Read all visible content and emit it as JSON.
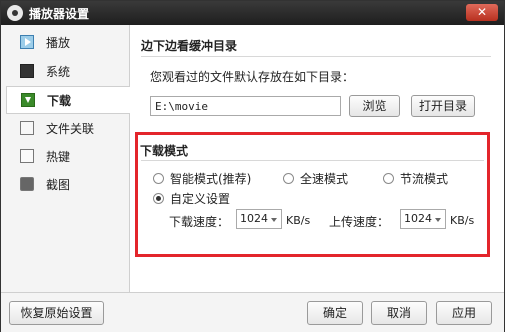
{
  "window": {
    "title": "播放器设置",
    "close_label": "✕"
  },
  "sidebar": {
    "items": [
      {
        "label": "播放",
        "icon": "play-icon"
      },
      {
        "label": "系统",
        "icon": "system-icon"
      },
      {
        "label": "下载",
        "icon": "download-icon"
      },
      {
        "label": "文件关联",
        "icon": "file-association-icon"
      },
      {
        "label": "热键",
        "icon": "hotkey-icon"
      },
      {
        "label": "截图",
        "icon": "camera-icon"
      }
    ],
    "active_index": 2
  },
  "cache": {
    "title": "边下边看缓冲目录",
    "hint": "您观看过的文件默认存放在如下目录：",
    "path_value": "E:\\movie",
    "browse_label": "浏览",
    "open_dir_label": "打开目录"
  },
  "download_mode": {
    "title": "下载模式",
    "options": [
      {
        "label": "智能模式(推荐)",
        "checked": false
      },
      {
        "label": "全速模式",
        "checked": false
      },
      {
        "label": "节流模式",
        "checked": false
      },
      {
        "label": "自定义设置",
        "checked": true
      }
    ],
    "download_speed_label": "下载速度：",
    "download_speed_value": "1024",
    "upload_speed_label": "上传速度：",
    "upload_speed_value": "1024",
    "unit": "KB/s",
    "highlight_color": "#e3252b"
  },
  "footer": {
    "restore_label": "恢复原始设置",
    "ok_label": "确定",
    "cancel_label": "取消",
    "apply_label": "应用"
  }
}
